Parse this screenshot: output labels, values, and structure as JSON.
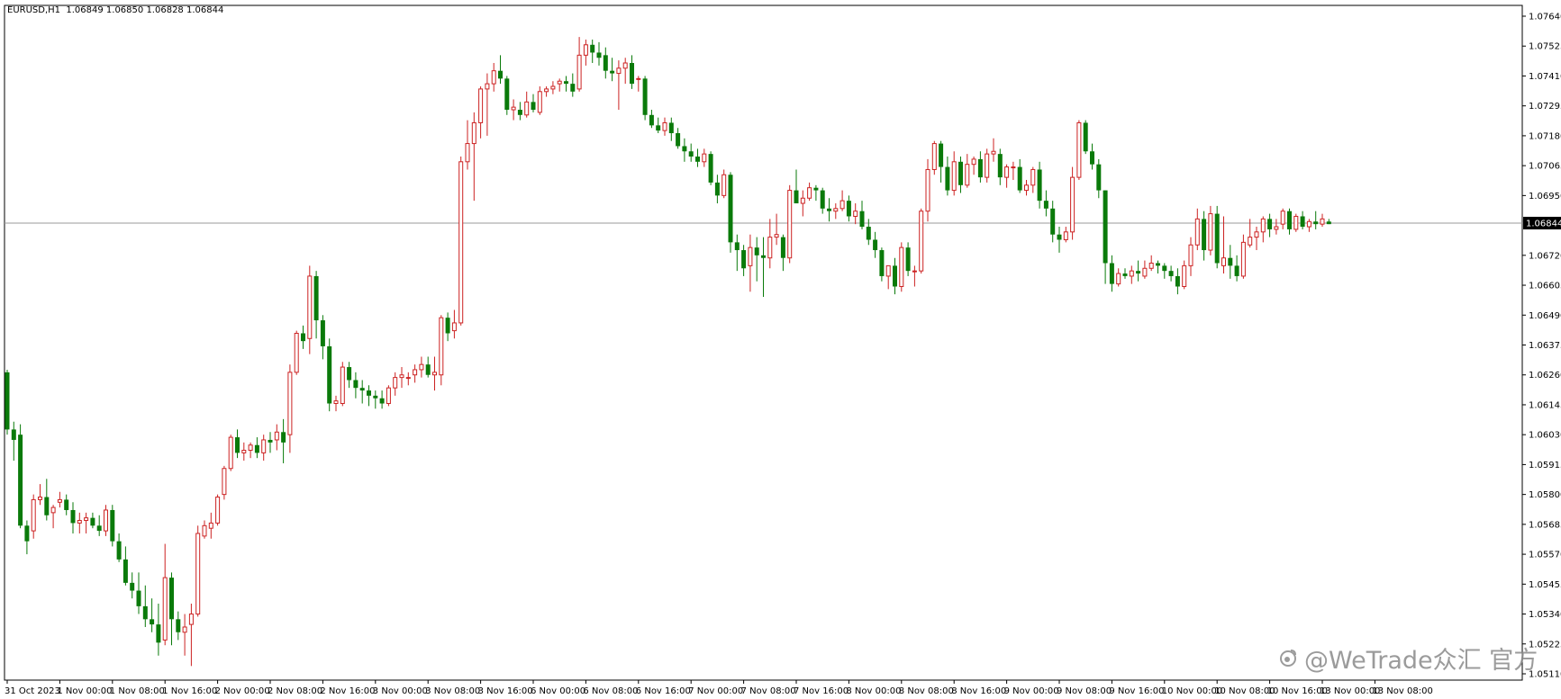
{
  "header": {
    "symbol_timeframe": "EURUSD,H1",
    "ohlc": "1.06849 1.06850 1.06828 1.06844"
  },
  "watermark": {
    "icon": "weibo-icon",
    "text": "@WeTrade众汇 官方"
  },
  "colors": {
    "bull": "#cc2222",
    "bear": "#0a7a0a",
    "axis": "#000000",
    "price_line": "#9a9a9a",
    "price_tag_bg": "#000000",
    "price_tag_text": "#ffffff"
  },
  "chart_data": {
    "type": "candlestick",
    "symbol": "EURUSD",
    "timeframe": "H1",
    "grid": false,
    "current_price": "1.06844",
    "ylim": [
      1.0511,
      1.0764
    ],
    "y_ticks": [
      "1.07640",
      "1.07525",
      "1.07410",
      "1.07295",
      "1.07180",
      "1.07065",
      "1.06950",
      "1.06720",
      "1.06605",
      "1.06490",
      "1.06375",
      "1.06260",
      "1.06145",
      "1.06030",
      "1.05915",
      "1.05800",
      "1.05685",
      "1.05570",
      "1.05455",
      "1.05340",
      "1.05225",
      "1.05110"
    ],
    "x_ticks": [
      {
        "label": "31 Oct 2023",
        "index": 0
      },
      {
        "label": "1 Nov 00:00",
        "index": 8
      },
      {
        "label": "1 Nov 08:00",
        "index": 16
      },
      {
        "label": "1 Nov 16:00",
        "index": 24
      },
      {
        "label": "2 Nov 00:00",
        "index": 32
      },
      {
        "label": "2 Nov 08:00",
        "index": 40
      },
      {
        "label": "2 Nov 16:00",
        "index": 48
      },
      {
        "label": "3 Nov 00:00",
        "index": 56
      },
      {
        "label": "3 Nov 08:00",
        "index": 64
      },
      {
        "label": "3 Nov 16:00",
        "index": 72
      },
      {
        "label": "6 Nov 00:00",
        "index": 80
      },
      {
        "label": "6 Nov 08:00",
        "index": 88
      },
      {
        "label": "6 Nov 16:00",
        "index": 96
      },
      {
        "label": "7 Nov 00:00",
        "index": 104
      },
      {
        "label": "7 Nov 08:00",
        "index": 112
      },
      {
        "label": "7 Nov 16:00",
        "index": 120
      },
      {
        "label": "8 Nov 00:00",
        "index": 128
      },
      {
        "label": "8 Nov 08:00",
        "index": 136
      },
      {
        "label": "8 Nov 16:00",
        "index": 144
      },
      {
        "label": "9 Nov 00:00",
        "index": 152
      },
      {
        "label": "9 Nov 08:00",
        "index": 160
      },
      {
        "label": "9 Nov 16:00",
        "index": 168
      },
      {
        "label": "10 Nov 00:00",
        "index": 176
      },
      {
        "label": "10 Nov 08:00",
        "index": 184
      },
      {
        "label": "10 Nov 16:00",
        "index": 192
      },
      {
        "label": "13 Nov 00:00",
        "index": 200
      },
      {
        "label": "13 Nov 08:00",
        "index": 208
      }
    ],
    "candles": [
      [
        1.0627,
        1.0628,
        1.0603,
        1.0605
      ],
      [
        1.0605,
        1.0608,
        1.0593,
        1.0601
      ],
      [
        1.0603,
        1.0607,
        1.0567,
        1.0568
      ],
      [
        1.0568,
        1.057,
        1.0557,
        1.0562
      ],
      [
        1.0566,
        1.058,
        1.0563,
        1.0578
      ],
      [
        1.0578,
        1.0584,
        1.0576,
        1.0579
      ],
      [
        1.0579,
        1.0586,
        1.057,
        1.0572
      ],
      [
        1.0573,
        1.0576,
        1.0567,
        1.0575
      ],
      [
        1.0577,
        1.0581,
        1.0575,
        1.0578
      ],
      [
        1.0578,
        1.058,
        1.0572,
        1.0574
      ],
      [
        1.0574,
        1.0577,
        1.0565,
        1.0569
      ],
      [
        1.0569,
        1.0573,
        1.0565,
        1.057
      ],
      [
        1.057,
        1.0573,
        1.0565,
        1.0571
      ],
      [
        1.0571,
        1.0573,
        1.0567,
        1.0568
      ],
      [
        1.0568,
        1.0572,
        1.0564,
        1.0566
      ],
      [
        1.0566,
        1.0576,
        1.0564,
        1.0574
      ],
      [
        1.0574,
        1.0576,
        1.056,
        1.0562
      ],
      [
        1.0562,
        1.0565,
        1.0554,
        1.0555
      ],
      [
        1.0555,
        1.056,
        1.0545,
        1.0546
      ],
      [
        1.0546,
        1.055,
        1.054,
        1.0543
      ],
      [
        1.0543,
        1.055,
        1.0534,
        1.0537
      ],
      [
        1.0537,
        1.0545,
        1.0529,
        1.0532
      ],
      [
        1.0532,
        1.054,
        1.0527,
        1.053
      ],
      [
        1.053,
        1.0538,
        1.0518,
        1.0523
      ],
      [
        1.0524,
        1.0561,
        1.0522,
        1.0548
      ],
      [
        1.0548,
        1.055,
        1.0522,
        1.0532
      ],
      [
        1.0532,
        1.0535,
        1.0524,
        1.0527
      ],
      [
        1.0527,
        1.0534,
        1.0518,
        1.0529
      ],
      [
        1.053,
        1.0538,
        1.0514,
        1.0534
      ],
      [
        1.0534,
        1.0568,
        1.0533,
        1.0565
      ],
      [
        1.0564,
        1.057,
        1.0563,
        1.0568
      ],
      [
        1.0567,
        1.0573,
        1.0563,
        1.0569
      ],
      [
        1.0569,
        1.058,
        1.0568,
        1.0579
      ],
      [
        1.058,
        1.0591,
        1.0578,
        1.059
      ],
      [
        1.059,
        1.0603,
        1.0589,
        1.0602
      ],
      [
        1.0602,
        1.0605,
        1.0594,
        1.0596
      ],
      [
        1.0596,
        1.06,
        1.0593,
        1.0597
      ],
      [
        1.0597,
        1.06,
        1.0594,
        1.0599
      ],
      [
        1.0599,
        1.0602,
        1.0594,
        1.0596
      ],
      [
        1.0596,
        1.0603,
        1.0593,
        1.0601
      ],
      [
        1.0601,
        1.0604,
        1.0596,
        1.06
      ],
      [
        1.0601,
        1.0607,
        1.0597,
        1.0604
      ],
      [
        1.0604,
        1.0609,
        1.0592,
        1.06
      ],
      [
        1.0603,
        1.063,
        1.0596,
        1.0627
      ],
      [
        1.0627,
        1.0643,
        1.0626,
        1.0642
      ],
      [
        1.0642,
        1.0645,
        1.0636,
        1.0639
      ],
      [
        1.064,
        1.0668,
        1.0634,
        1.0664
      ],
      [
        1.0664,
        1.0666,
        1.064,
        1.0647
      ],
      [
        1.0647,
        1.0649,
        1.0632,
        1.0637
      ],
      [
        1.0637,
        1.064,
        1.0612,
        1.0615
      ],
      [
        1.0615,
        1.0618,
        1.0612,
        1.0616
      ],
      [
        1.0615,
        1.0631,
        1.0614,
        1.0629
      ],
      [
        1.0629,
        1.0631,
        1.0621,
        1.0624
      ],
      [
        1.0624,
        1.0627,
        1.0617,
        1.0621
      ],
      [
        1.0621,
        1.0624,
        1.0615,
        1.062
      ],
      [
        1.062,
        1.0622,
        1.0614,
        1.0618
      ],
      [
        1.0618,
        1.062,
        1.0613,
        1.0617
      ],
      [
        1.0617,
        1.062,
        1.0613,
        1.0615
      ],
      [
        1.0615,
        1.0622,
        1.0614,
        1.0621
      ],
      [
        1.0621,
        1.0627,
        1.0618,
        1.0625
      ],
      [
        1.0625,
        1.0629,
        1.0621,
        1.0626
      ],
      [
        1.0625,
        1.0627,
        1.0622,
        1.0625
      ],
      [
        1.0626,
        1.063,
        1.0623,
        1.0628
      ],
      [
        1.0628,
        1.0633,
        1.0625,
        1.063
      ],
      [
        1.063,
        1.0633,
        1.0625,
        1.0626
      ],
      [
        1.0626,
        1.0633,
        1.062,
        1.0627
      ],
      [
        1.0626,
        1.0649,
        1.0622,
        1.0648
      ],
      [
        1.0648,
        1.065,
        1.0639,
        1.0642
      ],
      [
        1.0643,
        1.0651,
        1.064,
        1.0646
      ],
      [
        1.0646,
        1.071,
        1.0645,
        1.0708
      ],
      [
        1.0708,
        1.0724,
        1.0705,
        1.0715
      ],
      [
        1.0715,
        1.0727,
        1.0693,
        1.0723
      ],
      [
        1.0723,
        1.0737,
        1.0717,
        1.0736
      ],
      [
        1.0736,
        1.0742,
        1.0718,
        1.0738
      ],
      [
        1.0738,
        1.0746,
        1.0735,
        1.0743
      ],
      [
        1.0743,
        1.0749,
        1.0738,
        1.074
      ],
      [
        1.074,
        1.0741,
        1.0726,
        1.0728
      ],
      [
        1.0728,
        1.0732,
        1.0724,
        1.0729
      ],
      [
        1.0728,
        1.0731,
        1.0724,
        1.0726
      ],
      [
        1.0726,
        1.0735,
        1.0725,
        1.0731
      ],
      [
        1.0731,
        1.0734,
        1.0727,
        1.0728
      ],
      [
        1.0727,
        1.0737,
        1.0726,
        1.0735
      ],
      [
        1.0735,
        1.0737,
        1.0733,
        1.0736
      ],
      [
        1.0736,
        1.0739,
        1.0734,
        1.0737
      ],
      [
        1.0738,
        1.074,
        1.0735,
        1.0739
      ],
      [
        1.0739,
        1.0741,
        1.0735,
        1.0738
      ],
      [
        1.0738,
        1.0742,
        1.0733,
        1.0735
      ],
      [
        1.0736,
        1.0756,
        1.0735,
        1.0749
      ],
      [
        1.0749,
        1.0755,
        1.0745,
        1.0753
      ],
      [
        1.0753,
        1.0755,
        1.0746,
        1.075
      ],
      [
        1.075,
        1.0754,
        1.0745,
        1.0748
      ],
      [
        1.0749,
        1.0752,
        1.074,
        1.0743
      ],
      [
        1.0743,
        1.0748,
        1.0739,
        1.0742
      ],
      [
        1.0742,
        1.0747,
        1.0728,
        1.0744
      ],
      [
        1.0744,
        1.0748,
        1.0738,
        1.0746
      ],
      [
        1.0746,
        1.0749,
        1.0736,
        1.0738
      ],
      [
        1.074,
        1.0741,
        1.0735,
        1.074
      ],
      [
        1.074,
        1.0741,
        1.0724,
        1.0726
      ],
      [
        1.0726,
        1.0728,
        1.0721,
        1.0722
      ],
      [
        1.0722,
        1.0725,
        1.0719,
        1.072
      ],
      [
        1.072,
        1.0725,
        1.0718,
        1.0723
      ],
      [
        1.0723,
        1.0725,
        1.0716,
        1.0719
      ],
      [
        1.0719,
        1.0721,
        1.0713,
        1.0714
      ],
      [
        1.0714,
        1.0717,
        1.0708,
        1.0712
      ],
      [
        1.0712,
        1.0715,
        1.0708,
        1.071
      ],
      [
        1.071,
        1.0713,
        1.0706,
        1.0708
      ],
      [
        1.0708,
        1.0713,
        1.0706,
        1.0711
      ],
      [
        1.0711,
        1.0712,
        1.0699,
        1.07
      ],
      [
        1.07,
        1.0703,
        1.0692,
        1.0695
      ],
      [
        1.0695,
        1.0705,
        1.0694,
        1.0703
      ],
      [
        1.0703,
        1.0704,
        1.0673,
        1.0677
      ],
      [
        1.0677,
        1.068,
        1.0666,
        1.0674
      ],
      [
        1.0674,
        1.0676,
        1.0664,
        1.0667
      ],
      [
        1.0668,
        1.068,
        1.0658,
        1.0675
      ],
      [
        1.0675,
        1.0679,
        1.0662,
        1.0672
      ],
      [
        1.0672,
        1.0679,
        1.0656,
        1.0671
      ],
      [
        1.0671,
        1.0686,
        1.0667,
        1.0679
      ],
      [
        1.0679,
        1.0688,
        1.0676,
        1.068
      ],
      [
        1.0679,
        1.068,
        1.0666,
        1.0671
      ],
      [
        1.0671,
        1.0699,
        1.0669,
        1.0697
      ],
      [
        1.0697,
        1.0705,
        1.0692,
        1.0692
      ],
      [
        1.0692,
        1.0697,
        1.0687,
        1.0694
      ],
      [
        1.0694,
        1.07,
        1.0693,
        1.0698
      ],
      [
        1.0698,
        1.0699,
        1.0693,
        1.0697
      ],
      [
        1.0697,
        1.0698,
        1.0688,
        1.069
      ],
      [
        1.069,
        1.0694,
        1.0685,
        1.0689
      ],
      [
        1.0689,
        1.0692,
        1.0686,
        1.069
      ],
      [
        1.069,
        1.0697,
        1.0689,
        1.0693
      ],
      [
        1.0693,
        1.0695,
        1.0685,
        1.0687
      ],
      [
        1.0687,
        1.0692,
        1.0684,
        1.0689
      ],
      [
        1.0689,
        1.0693,
        1.0682,
        1.0683
      ],
      [
        1.0683,
        1.0686,
        1.0676,
        1.0678
      ],
      [
        1.0678,
        1.0681,
        1.0671,
        1.0674
      ],
      [
        1.0674,
        1.0675,
        1.0662,
        1.0664
      ],
      [
        1.0664,
        1.0668,
        1.0659,
        1.0668
      ],
      [
        1.0668,
        1.0671,
        1.0657,
        1.066
      ],
      [
        1.066,
        1.0677,
        1.0658,
        1.0675
      ],
      [
        1.0675,
        1.0677,
        1.0664,
        1.0666
      ],
      [
        1.0666,
        1.0668,
        1.066,
        1.0666
      ],
      [
        1.0666,
        1.069,
        1.0665,
        1.0689
      ],
      [
        1.0689,
        1.0709,
        1.0685,
        1.0705
      ],
      [
        1.0705,
        1.0716,
        1.0703,
        1.0715
      ],
      [
        1.0715,
        1.0716,
        1.07,
        1.0706
      ],
      [
        1.0706,
        1.071,
        1.0695,
        1.0697
      ],
      [
        1.0697,
        1.0712,
        1.0695,
        1.0708
      ],
      [
        1.0708,
        1.071,
        1.0696,
        1.0699
      ],
      [
        1.0699,
        1.0711,
        1.0698,
        1.0707
      ],
      [
        1.0707,
        1.071,
        1.0703,
        1.0709
      ],
      [
        1.0709,
        1.0712,
        1.07,
        1.0702
      ],
      [
        1.0702,
        1.0713,
        1.07,
        1.0711
      ],
      [
        1.0711,
        1.0717,
        1.0708,
        1.0712
      ],
      [
        1.0711,
        1.0713,
        1.0699,
        1.0702
      ],
      [
        1.0702,
        1.0707,
        1.0698,
        1.0706
      ],
      [
        1.0706,
        1.0708,
        1.0701,
        1.0706
      ],
      [
        1.0706,
        1.0709,
        1.0696,
        1.0697
      ],
      [
        1.0697,
        1.0701,
        1.0695,
        1.0699
      ],
      [
        1.0699,
        1.0706,
        1.0696,
        1.0705
      ],
      [
        1.0705,
        1.0708,
        1.069,
        1.0693
      ],
      [
        1.0693,
        1.0697,
        1.0687,
        1.069
      ],
      [
        1.069,
        1.0693,
        1.0677,
        1.068
      ],
      [
        1.068,
        1.0683,
        1.0673,
        1.0678
      ],
      [
        1.0678,
        1.0683,
        1.0677,
        1.0681
      ],
      [
        1.0681,
        1.0706,
        1.0678,
        1.0702
      ],
      [
        1.0702,
        1.0724,
        1.0701,
        1.0723
      ],
      [
        1.0723,
        1.0724,
        1.0711,
        1.0712
      ],
      [
        1.0712,
        1.0715,
        1.0705,
        1.0707
      ],
      [
        1.0707,
        1.0709,
        1.0694,
        1.0697
      ],
      [
        1.0697,
        1.0697,
        1.0661,
        1.0669
      ],
      [
        1.0669,
        1.0672,
        1.0658,
        1.0661
      ],
      [
        1.0661,
        1.0667,
        1.066,
        1.0665
      ],
      [
        1.0665,
        1.0667,
        1.0663,
        1.0664
      ],
      [
        1.0664,
        1.0668,
        1.0661,
        1.0666
      ],
      [
        1.0666,
        1.067,
        1.0662,
        1.0665
      ],
      [
        1.0664,
        1.067,
        1.0663,
        1.0667
      ],
      [
        1.0667,
        1.0672,
        1.0666,
        1.0669
      ],
      [
        1.0669,
        1.067,
        1.0665,
        1.0668
      ],
      [
        1.0668,
        1.0669,
        1.0663,
        1.0666
      ],
      [
        1.0666,
        1.0668,
        1.0662,
        1.0664
      ],
      [
        1.0664,
        1.0667,
        1.0657,
        1.066
      ],
      [
        1.066,
        1.067,
        1.0659,
        1.0668
      ],
      [
        1.0668,
        1.0679,
        1.0664,
        1.0676
      ],
      [
        1.0676,
        1.069,
        1.0674,
        1.0686
      ],
      [
        1.0686,
        1.0689,
        1.067,
        1.0674
      ],
      [
        1.0674,
        1.0691,
        1.0672,
        1.0688
      ],
      [
        1.0688,
        1.0691,
        1.0667,
        1.0669
      ],
      [
        1.0668,
        1.0687,
        1.0665,
        1.0671
      ],
      [
        1.0671,
        1.0676,
        1.0663,
        1.0668
      ],
      [
        1.0668,
        1.0672,
        1.0662,
        1.0664
      ],
      [
        1.0664,
        1.068,
        1.0663,
        1.0677
      ],
      [
        1.0676,
        1.0686,
        1.0675,
        1.0679
      ],
      [
        1.0679,
        1.0683,
        1.0674,
        1.0681
      ],
      [
        1.0681,
        1.0687,
        1.0677,
        1.0686
      ],
      [
        1.0686,
        1.0688,
        1.0679,
        1.0682
      ],
      [
        1.0682,
        1.0686,
        1.068,
        1.0683
      ],
      [
        1.0684,
        1.069,
        1.0682,
        1.0689
      ],
      [
        1.0689,
        1.069,
        1.068,
        1.0682
      ],
      [
        1.0682,
        1.0688,
        1.0681,
        1.0687
      ],
      [
        1.0687,
        1.0689,
        1.0682,
        1.0683
      ],
      [
        1.0683,
        1.0686,
        1.0681,
        1.0685
      ],
      [
        1.0685,
        1.0689,
        1.0682,
        1.0684
      ],
      [
        1.0684,
        1.0688,
        1.0683,
        1.0686
      ],
      [
        1.0685,
        1.0686,
        1.0684,
        1.0684
      ]
    ]
  }
}
